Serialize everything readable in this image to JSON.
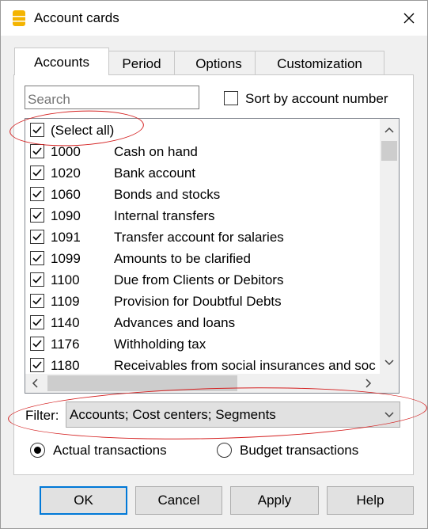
{
  "window": {
    "title": "Account cards",
    "close_symbol": "✕"
  },
  "tabs": [
    {
      "label": "Accounts",
      "active": true
    },
    {
      "label": "Period",
      "active": false
    },
    {
      "label": "Options",
      "active": false
    },
    {
      "label": "Customization",
      "active": false
    }
  ],
  "search": {
    "placeholder": "Search",
    "value": ""
  },
  "sort_option": {
    "label": "Sort by account number",
    "checked": false
  },
  "select_all": {
    "label": "(Select all)",
    "checked": true
  },
  "accounts": [
    {
      "code": "1000",
      "name": "Cash on hand",
      "checked": true
    },
    {
      "code": "1020",
      "name": "Bank account",
      "checked": true
    },
    {
      "code": "1060",
      "name": "Bonds and stocks",
      "checked": true
    },
    {
      "code": "1090",
      "name": "Internal transfers",
      "checked": true
    },
    {
      "code": "1091",
      "name": "Transfer account for salaries",
      "checked": true
    },
    {
      "code": "1099",
      "name": "Amounts to be clarified",
      "checked": true
    },
    {
      "code": "1100",
      "name": "Due from Clients or Debitors",
      "checked": true
    },
    {
      "code": "1109",
      "name": "Provision for Doubtful Debts",
      "checked": true
    },
    {
      "code": "1140",
      "name": "Advances and loans",
      "checked": true
    },
    {
      "code": "1176",
      "name": "Withholding tax",
      "checked": true
    },
    {
      "code": "1180",
      "name": "Receivables from social insurances and soc",
      "checked": true
    }
  ],
  "filter": {
    "label": "Filter:",
    "value": "Accounts; Cost centers; Segments"
  },
  "transaction_type": [
    {
      "label": "Actual transactions",
      "selected": true
    },
    {
      "label": "Budget transactions",
      "selected": false
    }
  ],
  "buttons": {
    "ok": "OK",
    "cancel": "Cancel",
    "apply": "Apply",
    "help": "Help"
  },
  "colors": {
    "annotation": "#d42020",
    "focus": "#0078d7"
  }
}
